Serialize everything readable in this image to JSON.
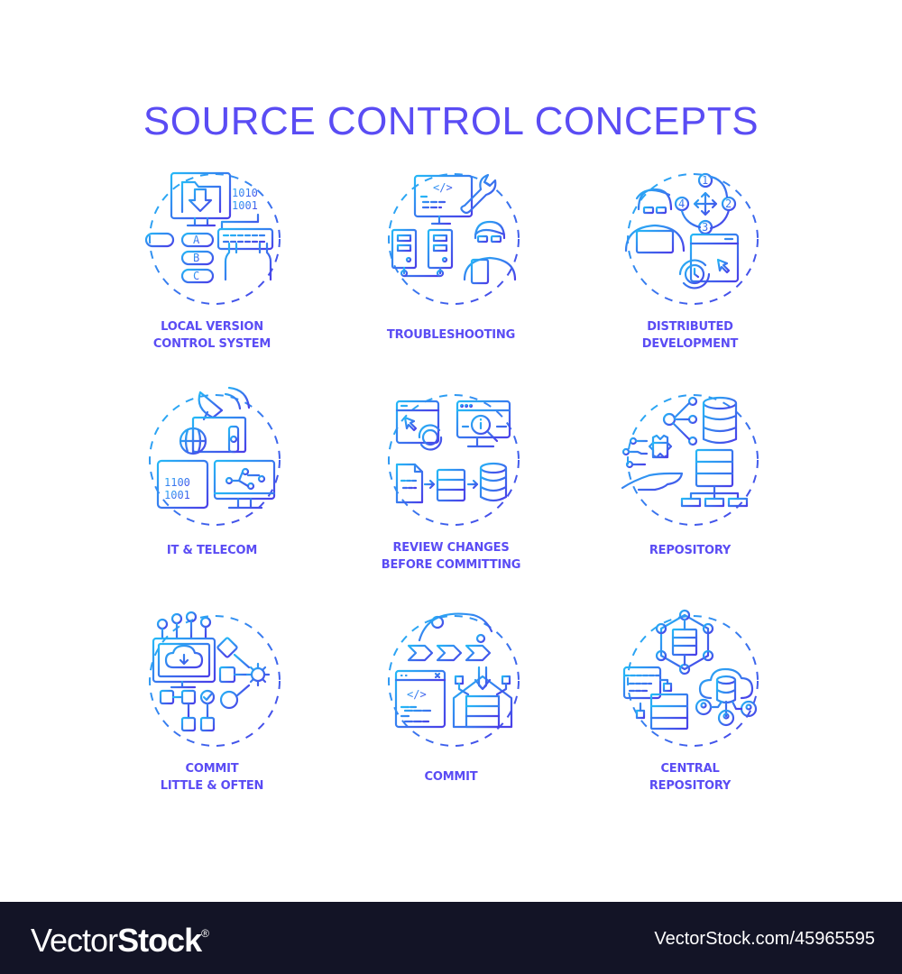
{
  "title": "SOURCE CONTROL CONCEPTS",
  "colors": {
    "accent": "#5a4cf4",
    "gradient_start": "#25b8f6",
    "gradient_end": "#4a3ee8",
    "footer_bg": "#131426"
  },
  "concepts": [
    {
      "icon": "local-version-control-icon",
      "label_line1": "LOCAL VERSION",
      "label_line2": "CONTROL SYSTEM",
      "binary_top": "1010",
      "binary_bottom": "1001",
      "nodes": [
        "A",
        "B",
        "C"
      ]
    },
    {
      "icon": "troubleshooting-icon",
      "label_line1": "TROUBLESHOOTING",
      "label_line2": "",
      "code_tag": "</>"
    },
    {
      "icon": "distributed-development-icon",
      "label_line1": "DISTRIBUTED",
      "label_line2": "DEVELOPMENT",
      "steps": [
        "1",
        "2",
        "3",
        "4"
      ]
    },
    {
      "icon": "it-telecom-icon",
      "label_line1": "IT & TELECOM",
      "label_line2": "",
      "binary_top": "1100",
      "binary_bottom": "1001"
    },
    {
      "icon": "review-changes-icon",
      "label_line1": "REVIEW CHANGES",
      "label_line2": "BEFORE COMMITTING"
    },
    {
      "icon": "repository-icon",
      "label_line1": "REPOSITORY",
      "label_line2": ""
    },
    {
      "icon": "commit-little-often-icon",
      "label_line1": "COMMIT",
      "label_line2": "LITTLE & OFTEN"
    },
    {
      "icon": "commit-icon",
      "label_line1": "COMMIT",
      "label_line2": "",
      "code_tag": "</>"
    },
    {
      "icon": "central-repository-icon",
      "label_line1": "CENTRAL",
      "label_line2": "REPOSITORY"
    }
  ],
  "footer": {
    "brand_light": "Vector",
    "brand_bold": "Stock",
    "brand_mark": "®",
    "url": "VectorStock.com/45965595"
  }
}
